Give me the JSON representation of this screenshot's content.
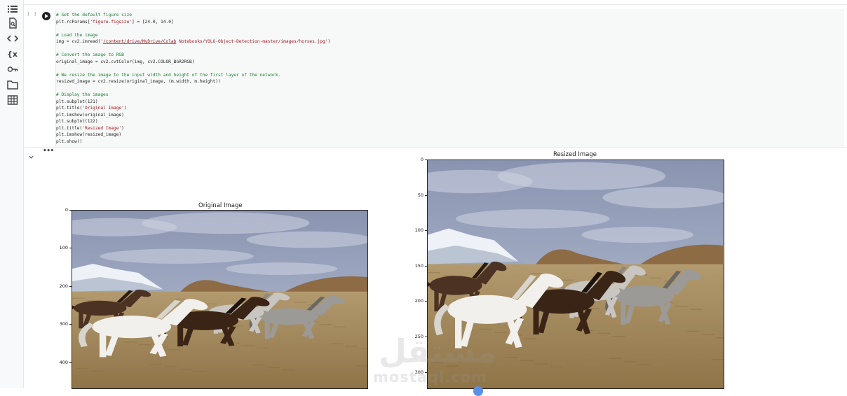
{
  "sidebar": {
    "items": [
      {
        "icon": "table-of-contents-icon"
      },
      {
        "icon": "find-replace-icon"
      },
      {
        "icon": "code-snippets-icon"
      },
      {
        "icon": "variables-inspector-icon"
      },
      {
        "icon": "secrets-key-icon"
      },
      {
        "icon": "files-folder-icon"
      },
      {
        "icon": "data-table-icon"
      }
    ]
  },
  "cell": {
    "exec_count": "[ ]",
    "code": [
      {
        "parts": [
          {
            "t": "# Set the default figure size",
            "c": "cm"
          }
        ]
      },
      {
        "parts": [
          {
            "t": "plt.rcParams[",
            "c": "fn"
          },
          {
            "t": "'figure.figsize'",
            "c": "st"
          },
          {
            "t": "] = [24.0, 14.0]",
            "c": "fn"
          }
        ]
      },
      {
        "parts": []
      },
      {
        "parts": [
          {
            "t": "# Load the image",
            "c": "cm"
          }
        ]
      },
      {
        "parts": [
          {
            "t": "img = cv2.imread(",
            "c": "fn"
          },
          {
            "t": "'",
            "c": "st"
          },
          {
            "t": "/content/drive/MyDrive/Colab",
            "c": "st-link"
          },
          {
            "t": " Notebooks/YOLO-Object-Detection-master/images/horses.jpg'",
            "c": "st"
          },
          {
            "t": ")",
            "c": "fn"
          }
        ]
      },
      {
        "parts": []
      },
      {
        "parts": [
          {
            "t": "# Convert the image to RGB",
            "c": "cm"
          }
        ]
      },
      {
        "parts": [
          {
            "t": "original_image = cv2.cvtColor(img, cv2.COLOR_BGR2RGB)",
            "c": "fn"
          }
        ]
      },
      {
        "parts": []
      },
      {
        "parts": [
          {
            "t": "# We resize the image to the input width and height of the first layer of the network.",
            "c": "cm"
          }
        ]
      },
      {
        "parts": [
          {
            "t": "resized_image = cv2.resize(original_image, (m.width, m.height))",
            "c": "fn"
          }
        ]
      },
      {
        "parts": []
      },
      {
        "parts": [
          {
            "t": "# Display the images",
            "c": "cm"
          }
        ]
      },
      {
        "parts": [
          {
            "t": "plt.subplot(121)",
            "c": "fn"
          }
        ]
      },
      {
        "parts": [
          {
            "t": "plt.title(",
            "c": "fn"
          },
          {
            "t": "'Original Image'",
            "c": "st"
          },
          {
            "t": ")",
            "c": "fn"
          }
        ]
      },
      {
        "parts": [
          {
            "t": "plt.imshow(original_image)",
            "c": "fn"
          }
        ]
      },
      {
        "parts": [
          {
            "t": "plt.subplot(122)",
            "c": "fn"
          }
        ]
      },
      {
        "parts": [
          {
            "t": "plt.title(",
            "c": "fn"
          },
          {
            "t": "'Resized Image'",
            "c": "st"
          },
          {
            "t": ")",
            "c": "fn"
          }
        ]
      },
      {
        "parts": [
          {
            "t": "plt.imshow(resized_image)",
            "c": "fn"
          }
        ]
      },
      {
        "parts": [
          {
            "t": "plt.show()",
            "c": "fn"
          }
        ]
      }
    ]
  },
  "output": {
    "menu_label": "•••",
    "original": {
      "title": "Original Image",
      "y_ticks": [
        "0",
        "100",
        "200",
        "300",
        "400"
      ]
    },
    "resized": {
      "title": "Resized Image",
      "y_ticks": [
        "0",
        "50",
        "100",
        "150",
        "200",
        "250",
        "300"
      ]
    }
  },
  "watermark": {
    "arabic": "مستقل",
    "latin": "mostaql.com"
  },
  "colors": {
    "sky_top": "#8a94b0",
    "sky_bottom": "#b9c1d6",
    "field": "#a8885a",
    "code_bg": "#f7f8f8",
    "comment": "#1b7f36",
    "string": "#a3151d"
  }
}
